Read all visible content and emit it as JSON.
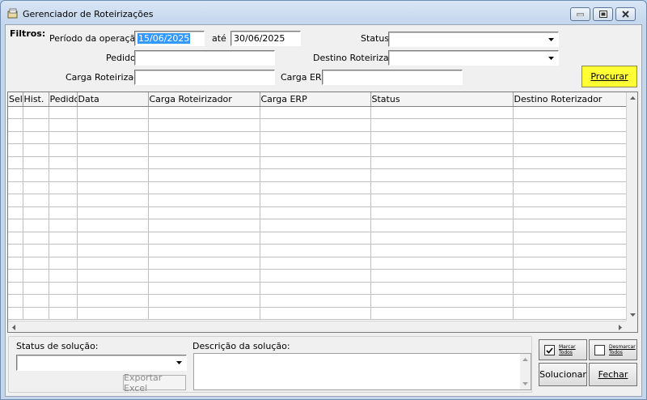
{
  "window": {
    "title": "Gerenciador de Roteirizações"
  },
  "filters": {
    "heading": "Filtros:",
    "period_label": "Período da operação de:",
    "period_from": "15/06/2025",
    "period_to_label": "até",
    "period_to": "30/06/2025",
    "status_label": "Status:",
    "status_value": "",
    "pedido_label": "Pedido:",
    "pedido_value": "",
    "destino_label": "Destino Roteirizador:",
    "destino_value": "",
    "carga_rot_label": "Carga Roteirizador:",
    "carga_rot_value": "",
    "carga_erp_label": "Carga ERP:",
    "carga_erp_value": "",
    "search_button": "Procurar",
    "search_button_highlight": "#ffff33"
  },
  "grid": {
    "columns": [
      "Sel.",
      "Hist.",
      "Pedidos",
      "Data",
      "Carga Roteirizador",
      "Carga ERP",
      "Status",
      "Destino Roterizador"
    ],
    "rows": []
  },
  "solution": {
    "status_label": "Status de solução:",
    "status_value": "",
    "description_label": "Descrição da solução:",
    "description_value": "",
    "export_button": "Exportar Excel",
    "mark_all": "Marcar Todos",
    "unmark_all": "Desmarcar Todos",
    "solve_button": "Solucionar",
    "close_button": "Fechar"
  }
}
